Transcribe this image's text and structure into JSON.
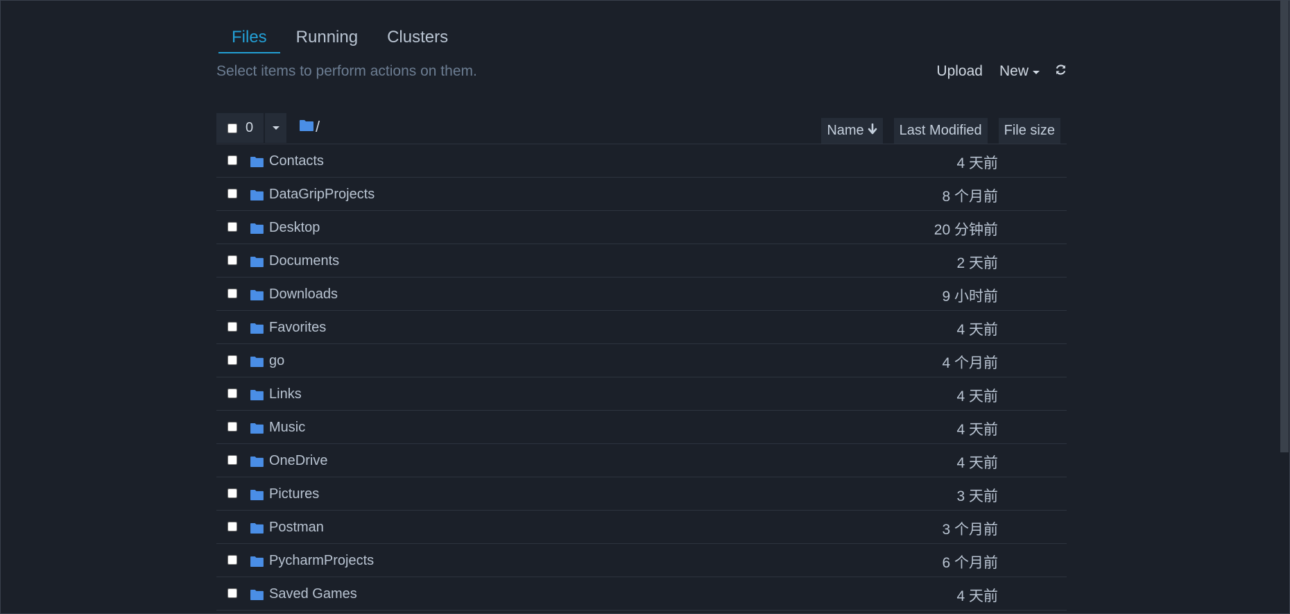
{
  "tabs": [
    {
      "label": "Files"
    },
    {
      "label": "Running"
    },
    {
      "label": "Clusters"
    }
  ],
  "hint": "Select items to perform actions on them.",
  "actions": {
    "upload_label": "Upload",
    "new_label": "New",
    "refresh_icon": "refresh-icon"
  },
  "toolbar": {
    "selected_count": "0",
    "breadcrumb_path": "/"
  },
  "columns": {
    "name": "Name",
    "last_modified": "Last Modified",
    "file_size": "File size"
  },
  "files": [
    {
      "name": "Contacts",
      "modified": "4 天前"
    },
    {
      "name": "DataGripProjects",
      "modified": "8 个月前"
    },
    {
      "name": "Desktop",
      "modified": "20 分钟前"
    },
    {
      "name": "Documents",
      "modified": "2 天前"
    },
    {
      "name": "Downloads",
      "modified": "9 小时前"
    },
    {
      "name": "Favorites",
      "modified": "4 天前"
    },
    {
      "name": "go",
      "modified": "4 个月前"
    },
    {
      "name": "Links",
      "modified": "4 天前"
    },
    {
      "name": "Music",
      "modified": "4 天前"
    },
    {
      "name": "OneDrive",
      "modified": "4 天前"
    },
    {
      "name": "Pictures",
      "modified": "3 天前"
    },
    {
      "name": "Postman",
      "modified": "3 个月前"
    },
    {
      "name": "PycharmProjects",
      "modified": "6 个月前"
    },
    {
      "name": "Saved Games",
      "modified": "4 天前"
    }
  ],
  "colors": {
    "accent": "#23a0d6",
    "folder": "#4a8ee6",
    "background": "#1b2029"
  }
}
